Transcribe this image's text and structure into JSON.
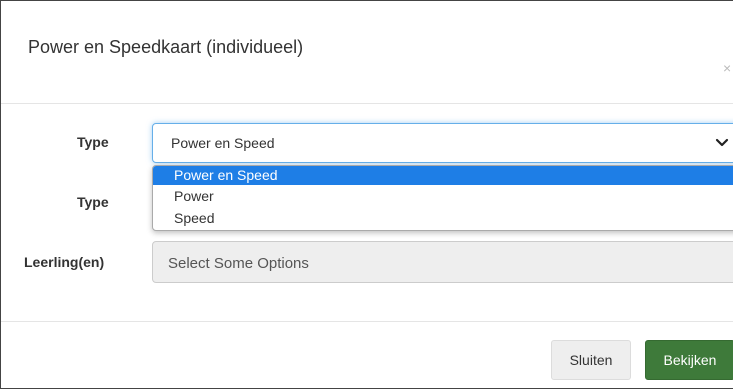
{
  "modal": {
    "title": "Power en Speedkaart (individueel)",
    "close_symbol": "×"
  },
  "form": {
    "type1_label": "Type",
    "type1_value": "Power en Speed",
    "type1_options": [
      "Power en Speed",
      "Power",
      "Speed"
    ],
    "type1_selected_index": 0,
    "type2_label": "Type",
    "students_label": "Leerling(en)",
    "students_placeholder": "Select Some Options"
  },
  "footer": {
    "close_label": "Sluiten",
    "view_label": "Bekijken"
  },
  "colors": {
    "selected_option": "#1e7ee6",
    "primary_button": "#3e7a3a",
    "focus_border": "#66afe9"
  },
  "icons": {
    "dropdown": "chevron-down-icon",
    "close": "close-icon"
  }
}
